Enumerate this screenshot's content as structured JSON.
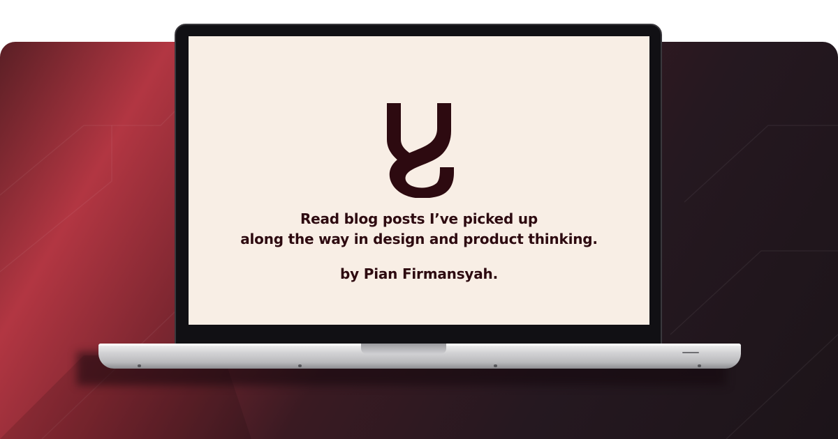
{
  "screen": {
    "logo_icon": "y-hook-logo-icon",
    "tagline_line1": "Read blog posts I’ve picked up",
    "tagline_line2": "along the way in design and product thinking.",
    "byline": "by Pian Firmansyah."
  },
  "colors": {
    "screen_background": "#f8eee5",
    "text": "#2d0a10",
    "accent_red": "#b23642",
    "dark_background": "#1c1419"
  }
}
